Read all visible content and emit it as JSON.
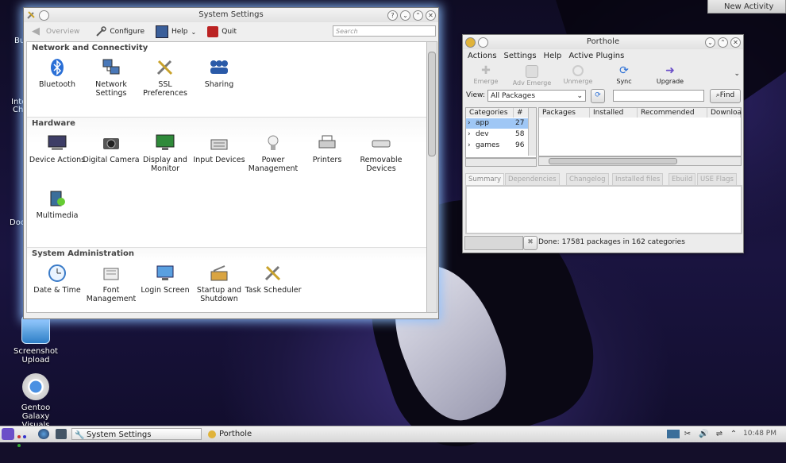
{
  "desktop": {
    "icons": [
      {
        "label": "Screenshot Upload"
      },
      {
        "label": "Gentoo Galaxy Visuals"
      }
    ],
    "cut_labels": [
      "Bu",
      "Inte",
      "Ch",
      "Doc"
    ],
    "new_activity": "New Activity"
  },
  "system_settings": {
    "title": "System Settings",
    "toolbar": {
      "overview": "Overview",
      "configure": "Configure",
      "help": "Help",
      "quit": "Quit",
      "search_placeholder": "Search"
    },
    "sections": [
      {
        "title": "Network and Connectivity",
        "items": [
          {
            "label": "Bluetooth",
            "icon": "bluetooth-icon"
          },
          {
            "label": "Network Settings",
            "icon": "network-icon"
          },
          {
            "label": "SSL Preferences",
            "icon": "ssl-icon"
          },
          {
            "label": "Sharing",
            "icon": "sharing-icon"
          }
        ]
      },
      {
        "title": "Hardware",
        "items": [
          {
            "label": "Device Actions",
            "icon": "device-actions-icon"
          },
          {
            "label": "Digital Camera",
            "icon": "camera-icon"
          },
          {
            "label": "Display and Monitor",
            "icon": "display-icon"
          },
          {
            "label": "Input Devices",
            "icon": "keyboard-icon"
          },
          {
            "label": "Power Management",
            "icon": "power-icon"
          },
          {
            "label": "Printers",
            "icon": "printer-icon"
          },
          {
            "label": "Removable Devices",
            "icon": "removable-icon"
          },
          {
            "label": "Multimedia",
            "icon": "multimedia-icon"
          }
        ]
      },
      {
        "title": "System Administration",
        "items": [
          {
            "label": "Date & Time",
            "icon": "clock-icon"
          },
          {
            "label": "Font Management",
            "icon": "font-icon"
          },
          {
            "label": "Login Screen",
            "icon": "login-icon"
          },
          {
            "label": "Startup and Shutdown",
            "icon": "startup-icon"
          },
          {
            "label": "Task Scheduler",
            "icon": "scheduler-icon"
          }
        ]
      }
    ]
  },
  "porthole": {
    "title": "Porthole",
    "menu": [
      "Actions",
      "Settings",
      "Help",
      "Active Plugins"
    ],
    "tools": [
      "Emerge",
      "Adv Emerge",
      "Unmerge",
      "Sync",
      "Upgrade"
    ],
    "view_label": "View:",
    "view_value": "All Packages",
    "find_label": "Find",
    "categories_header": [
      "Categories",
      "#"
    ],
    "categories": [
      {
        "name": "app",
        "count": "27"
      },
      {
        "name": "dev",
        "count": "58"
      },
      {
        "name": "games",
        "count": "96"
      }
    ],
    "package_headers": [
      "Packages",
      "Installed",
      "Recommended",
      "Downloa"
    ],
    "tabs": [
      "Summary",
      "Dependencies",
      "Changelog",
      "Installed files",
      "Ebuild",
      "USE Flags"
    ],
    "status": "Done: 17581 packages in 162 categories"
  },
  "taskbar": {
    "tasks": [
      "System Settings",
      "Porthole"
    ],
    "clock": "10:48 PM"
  }
}
